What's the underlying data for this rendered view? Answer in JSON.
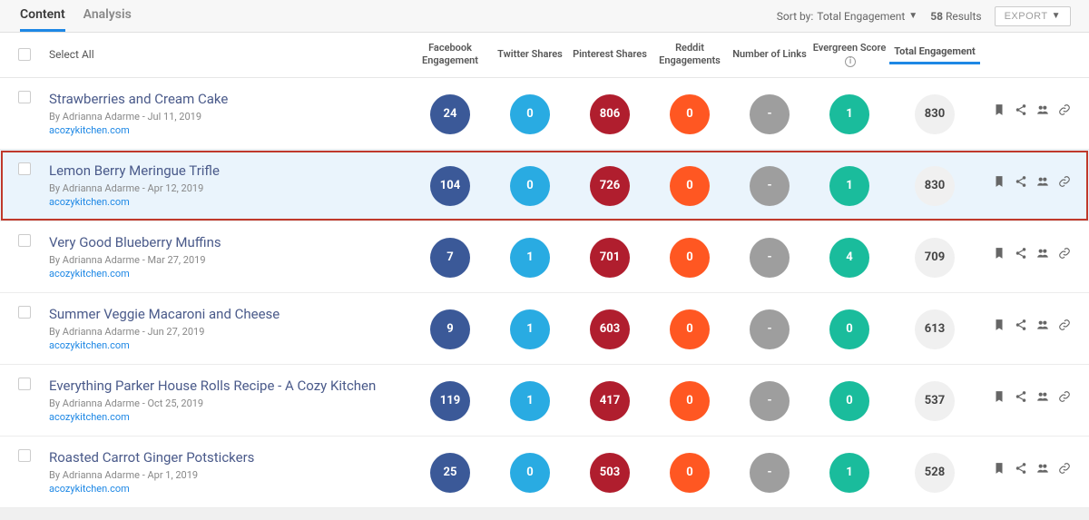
{
  "tabs": {
    "content": "Content",
    "analysis": "Analysis"
  },
  "sort": {
    "label": "Sort by:",
    "value": "Total Engagement"
  },
  "results": {
    "count": "58",
    "label": "Results"
  },
  "export_label": "EXPORT",
  "select_all": "Select All",
  "columns": {
    "fb": "Facebook Engagement",
    "tw": "Twitter Shares",
    "pin": "Pinterest Shares",
    "red": "Reddit Engagements",
    "links": "Number of Links",
    "ever": "Evergreen Score",
    "total": "Total Engagement"
  },
  "rows": [
    {
      "title": "Strawberries and Cream Cake",
      "meta": "By Adrianna Adarme - Jul 11, 2019",
      "domain": "acozykitchen.com",
      "fb": "24",
      "tw": "0",
      "pin": "806",
      "red": "0",
      "links": "-",
      "ever": "1",
      "total": "830",
      "highlighted": false
    },
    {
      "title": "Lemon Berry Meringue Trifle",
      "meta": "By Adrianna Adarme - Apr 12, 2019",
      "domain": "acozykitchen.com",
      "fb": "104",
      "tw": "0",
      "pin": "726",
      "red": "0",
      "links": "-",
      "ever": "1",
      "total": "830",
      "highlighted": true
    },
    {
      "title": "Very Good Blueberry Muffins",
      "meta": "By Adrianna Adarme - Mar 27, 2019",
      "domain": "acozykitchen.com",
      "fb": "7",
      "tw": "1",
      "pin": "701",
      "red": "0",
      "links": "-",
      "ever": "4",
      "total": "709",
      "highlighted": false
    },
    {
      "title": "Summer Veggie Macaroni and Cheese",
      "meta": "By Adrianna Adarme - Jun 27, 2019",
      "domain": "acozykitchen.com",
      "fb": "9",
      "tw": "1",
      "pin": "603",
      "red": "0",
      "links": "-",
      "ever": "0",
      "total": "613",
      "highlighted": false
    },
    {
      "title": "Everything Parker House Rolls Recipe - A Cozy Kitchen",
      "meta": "By Adrianna Adarme - Oct 25, 2019",
      "domain": "acozykitchen.com",
      "fb": "119",
      "tw": "1",
      "pin": "417",
      "red": "0",
      "links": "-",
      "ever": "0",
      "total": "537",
      "highlighted": false
    },
    {
      "title": "Roasted Carrot Ginger Potstickers",
      "meta": "By Adrianna Adarme - Apr 1, 2019",
      "domain": "acozykitchen.com",
      "fb": "25",
      "tw": "0",
      "pin": "503",
      "red": "0",
      "links": "-",
      "ever": "1",
      "total": "528",
      "highlighted": false
    }
  ]
}
